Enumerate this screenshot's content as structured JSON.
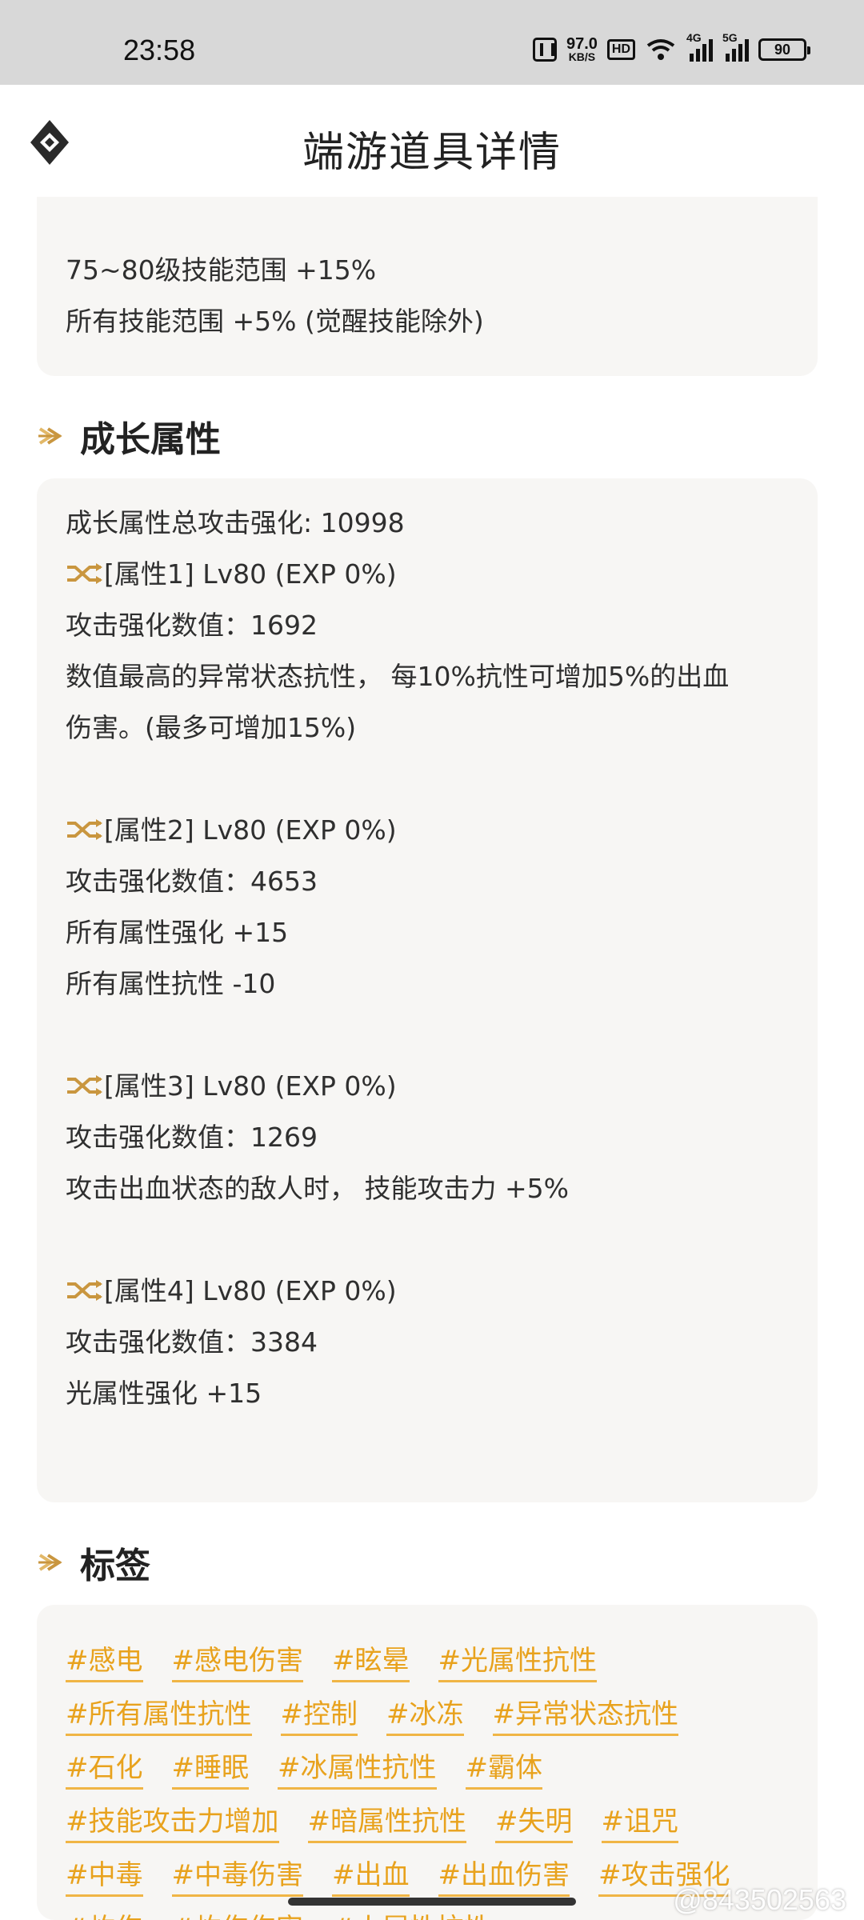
{
  "status_bar": {
    "time": "23:58",
    "net_speed": "97.0",
    "net_unit": "KB/S",
    "hd": "HD",
    "sig1": "4G",
    "sig2": "5G",
    "battery": "90"
  },
  "header": {
    "title": "端游道具详情"
  },
  "skill_card": {
    "lines": [
      "75~80级技能范围 +15%",
      "所有技能范围 +5% (觉醒技能除外)"
    ]
  },
  "growth": {
    "section_title": "成长属性",
    "lines": [
      "成长属性总攻击强化: 10998",
      "[属性1] Lv80 (EXP 0%)",
      "攻击强化数值：1692",
      "数值最高的异常状态抗性， 每10%抗性可增加5%的出血",
      "伤害。(最多可增加15%)",
      "",
      "[属性2] Lv80 (EXP 0%)",
      "攻击强化数值：4653",
      "所有属性强化 +15",
      "所有属性抗性 -10",
      "",
      "[属性3] Lv80 (EXP 0%)",
      "攻击强化数值：1269",
      "攻击出血状态的敌人时， 技能攻击力 +5%",
      "",
      "[属性4] Lv80 (EXP 0%)",
      "攻击强化数值：3384",
      "光属性强化 +15"
    ]
  },
  "tags": {
    "section_title": "标签",
    "items": [
      "#感电",
      "#感电伤害",
      "#眩晕",
      "#光属性抗性",
      "#所有属性抗性",
      "#控制",
      "#冰冻",
      "#异常状态抗性",
      "#石化",
      "#睡眠",
      "#冰属性抗性",
      "#霸体",
      "#技能攻击力增加",
      "#暗属性抗性",
      "#失明",
      "#诅咒",
      "#中毒",
      "#中毒伤害",
      "#出血",
      "#出血伤害",
      "#攻击强化",
      "#灼伤",
      "#灼伤伤害",
      "#火属性抗性"
    ]
  },
  "watermark": "@843502563"
}
